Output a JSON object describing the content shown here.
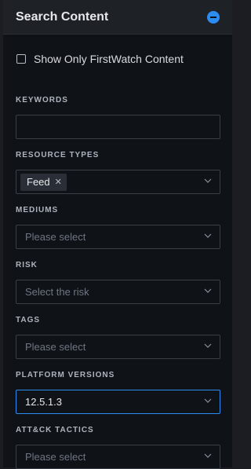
{
  "panel": {
    "title": "Search Content",
    "firstwatch_checkbox": {
      "label": "Show Only FirstWatch Content",
      "checked": false
    }
  },
  "fields": {
    "keywords": {
      "label": "KEYWORDS",
      "value": ""
    },
    "resource_types": {
      "label": "RESOURCE TYPES",
      "tags": [
        "Feed"
      ]
    },
    "mediums": {
      "label": "MEDIUMS",
      "placeholder": "Please select"
    },
    "risk": {
      "label": "RISK",
      "placeholder": "Select the risk"
    },
    "tags": {
      "label": "TAGS",
      "placeholder": "Please select"
    },
    "platform_versions": {
      "label": "PLATFORM VERSIONS",
      "value": "12.5.1.3"
    },
    "attck_tactics": {
      "label": "ATT&CK TACTICS",
      "placeholder": "Please select"
    }
  },
  "icons": {
    "collapse": "minus-circle-icon",
    "dropdown": "chevron-down-icon",
    "tag_remove": "close-icon"
  },
  "colors": {
    "accent": "#2d8cf0",
    "panel_bg": "#0f1217",
    "header_bg": "#1e2227",
    "border": "#3a3f47",
    "placeholder": "#6f7681"
  }
}
